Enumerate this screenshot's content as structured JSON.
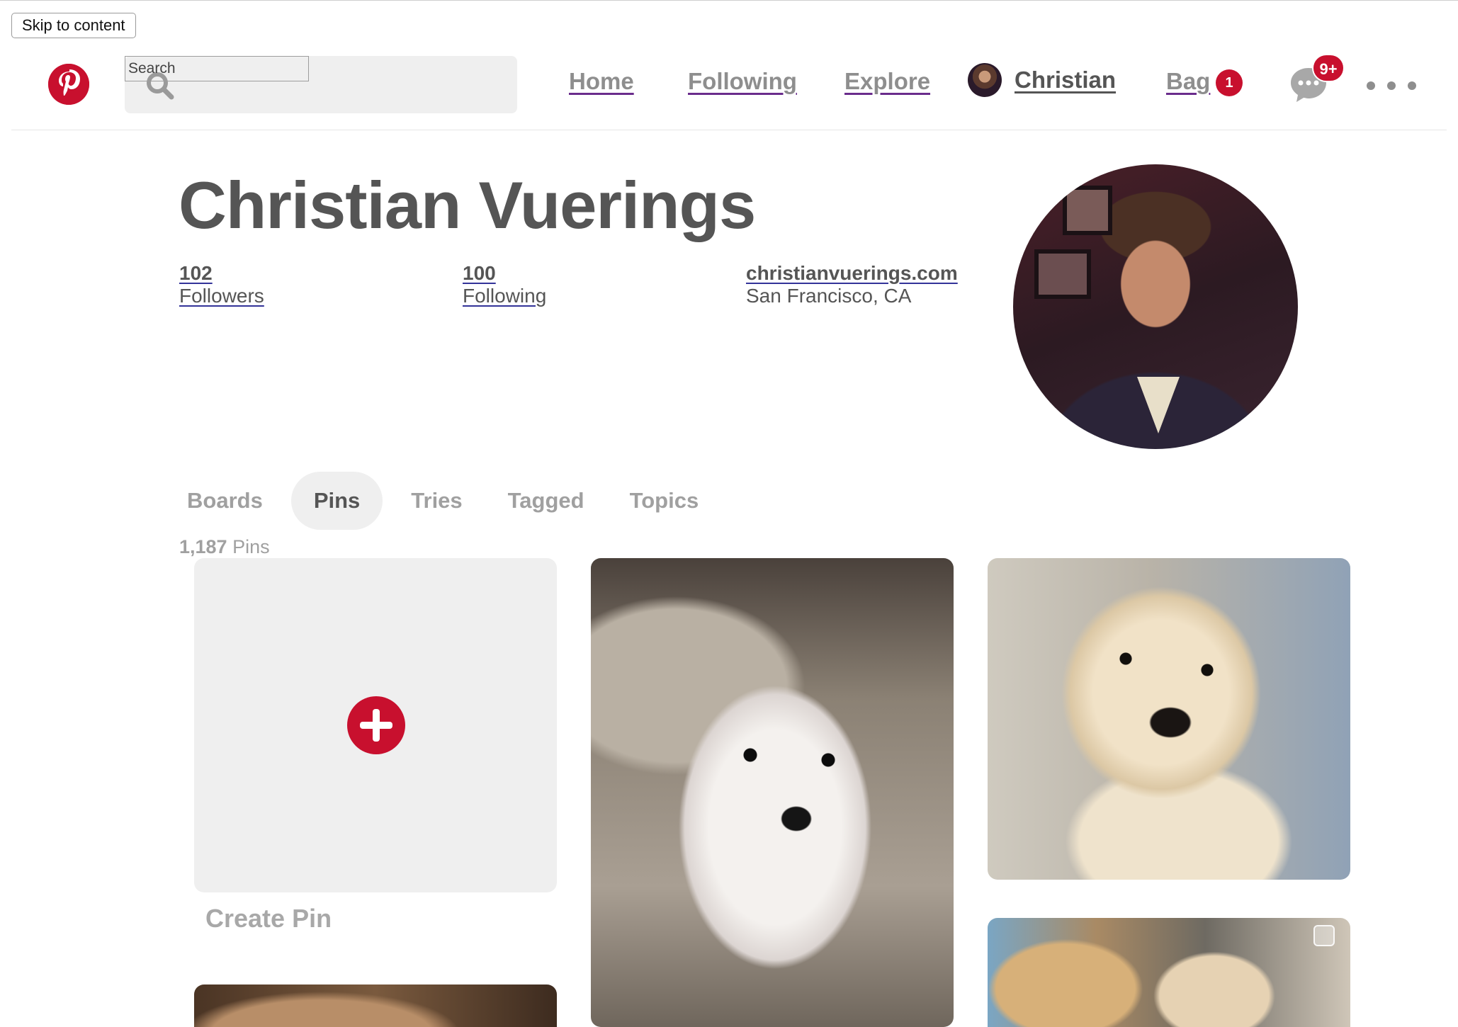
{
  "skip_link": "Skip to content",
  "header": {
    "search_placeholder": "Search",
    "nav": {
      "home": "Home",
      "following": "Following",
      "explore": "Explore",
      "user": "Christian",
      "bag": "Bag"
    },
    "bag_count": "1",
    "messages_count": "9+",
    "icons": [
      "pinterest-logo",
      "search-icon",
      "chat-bubble-icon",
      "more-icon"
    ]
  },
  "profile": {
    "name": "Christian Vuerings",
    "followers_count": "102",
    "followers_label": "Followers",
    "following_count": "100",
    "following_label": "Following",
    "website": "christianvuerings.com",
    "location": "San Francisco, CA"
  },
  "tabs": {
    "items": [
      "Boards",
      "Pins",
      "Tries",
      "Tagged",
      "Topics"
    ],
    "active": "Pins"
  },
  "pins": {
    "count": "1,187",
    "count_label": "Pins",
    "create_label": "Create Pin"
  },
  "colors": {
    "brand_red": "#c8102e",
    "text": "#555555",
    "muted": "#a0a0a0",
    "surface": "#efefef"
  }
}
